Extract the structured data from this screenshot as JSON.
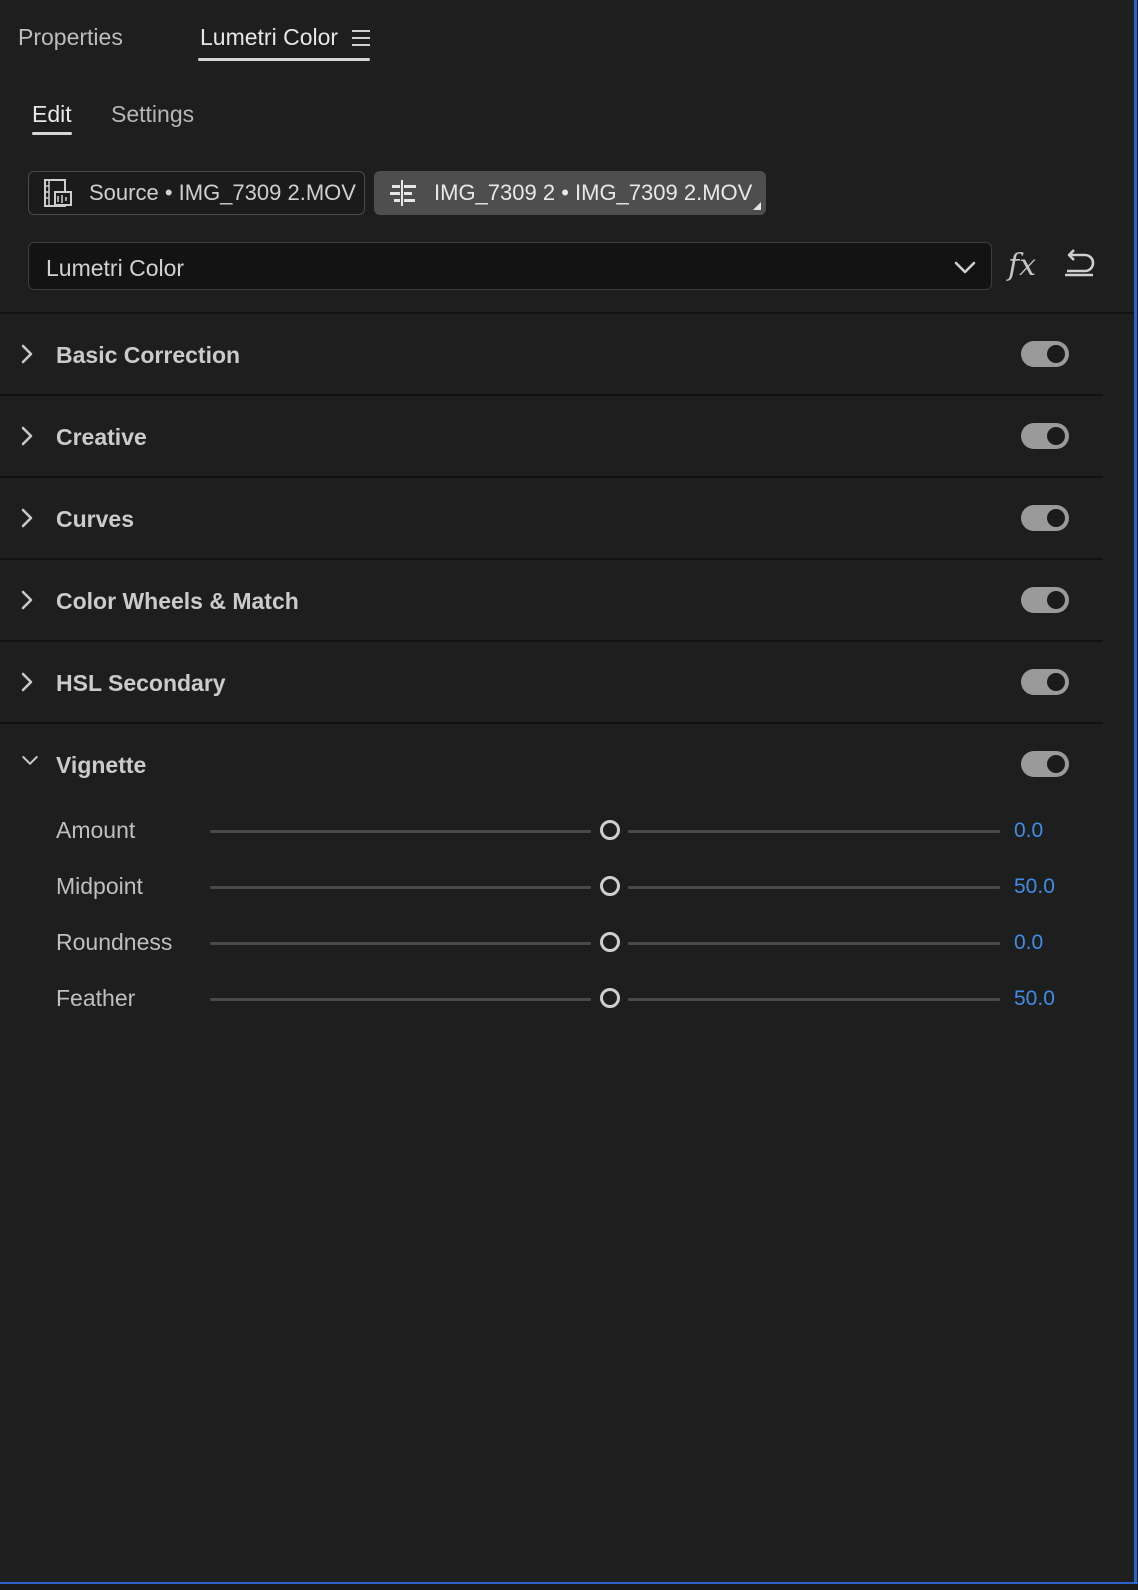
{
  "panel_tabs": {
    "properties": "Properties",
    "lumetri": "Lumetri Color"
  },
  "sub_tabs": {
    "edit": "Edit",
    "settings": "Settings"
  },
  "clips": {
    "source_label": "Source • IMG_7309 2.MOV",
    "sequence_label": "IMG_7309 2 • IMG_7309 2.MOV"
  },
  "effect_select": {
    "value": "Lumetri Color"
  },
  "fx_label": "fx",
  "sections": [
    {
      "title": "Basic Correction",
      "expanded": false,
      "enabled": true
    },
    {
      "title": "Creative",
      "expanded": false,
      "enabled": true
    },
    {
      "title": "Curves",
      "expanded": false,
      "enabled": true
    },
    {
      "title": "Color Wheels & Match",
      "expanded": false,
      "enabled": true
    },
    {
      "title": "HSL Secondary",
      "expanded": false,
      "enabled": true
    },
    {
      "title": "Vignette",
      "expanded": true,
      "enabled": true
    }
  ],
  "vignette": {
    "params": [
      {
        "label": "Amount",
        "value": "0.0"
      },
      {
        "label": "Midpoint",
        "value": "50.0"
      },
      {
        "label": "Roundness",
        "value": "0.0"
      },
      {
        "label": "Feather",
        "value": "50.0"
      }
    ]
  },
  "colors": {
    "accent_value": "#3d8ee6",
    "panel_bg": "#1e1e1e",
    "focus_border": "#2d62c8"
  }
}
